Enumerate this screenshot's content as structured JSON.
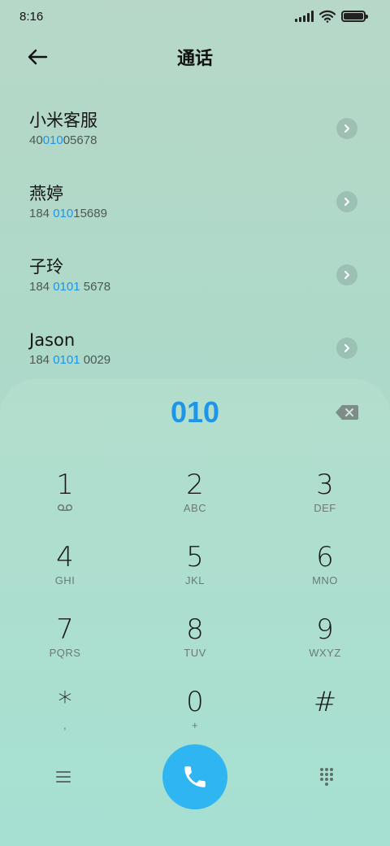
{
  "status_bar": {
    "time": "8:16"
  },
  "header": {
    "title": "通话",
    "back_icon": "arrow-left-icon"
  },
  "contacts": [
    {
      "name": "小米客服",
      "number_pre": "40",
      "number_match": "010",
      "number_post": "05678"
    },
    {
      "name": "燕婷",
      "number_pre": "184 ",
      "number_match": "010",
      "number_post": "15689"
    },
    {
      "name": "子玲",
      "number_pre": "184 ",
      "number_match": "0101",
      "number_post": " 5678"
    },
    {
      "name": "Jason",
      "number_pre": "184 ",
      "number_match": "0101",
      "number_post": " 0029"
    }
  ],
  "dialpad": {
    "input": "010",
    "keys": [
      {
        "digit": "1",
        "letters": ""
      },
      {
        "digit": "2",
        "letters": "ABC"
      },
      {
        "digit": "3",
        "letters": "DEF"
      },
      {
        "digit": "4",
        "letters": "GHI"
      },
      {
        "digit": "5",
        "letters": "JKL"
      },
      {
        "digit": "6",
        "letters": "MNO"
      },
      {
        "digit": "7",
        "letters": "PQRS"
      },
      {
        "digit": "8",
        "letters": "TUV"
      },
      {
        "digit": "9",
        "letters": "WXYZ"
      },
      {
        "digit": "*",
        "letters": ","
      },
      {
        "digit": "0",
        "letters": "+"
      },
      {
        "digit": "#",
        "letters": ""
      }
    ]
  },
  "colors": {
    "accent": "#1e95e8",
    "call_button": "#2fb5f2"
  }
}
